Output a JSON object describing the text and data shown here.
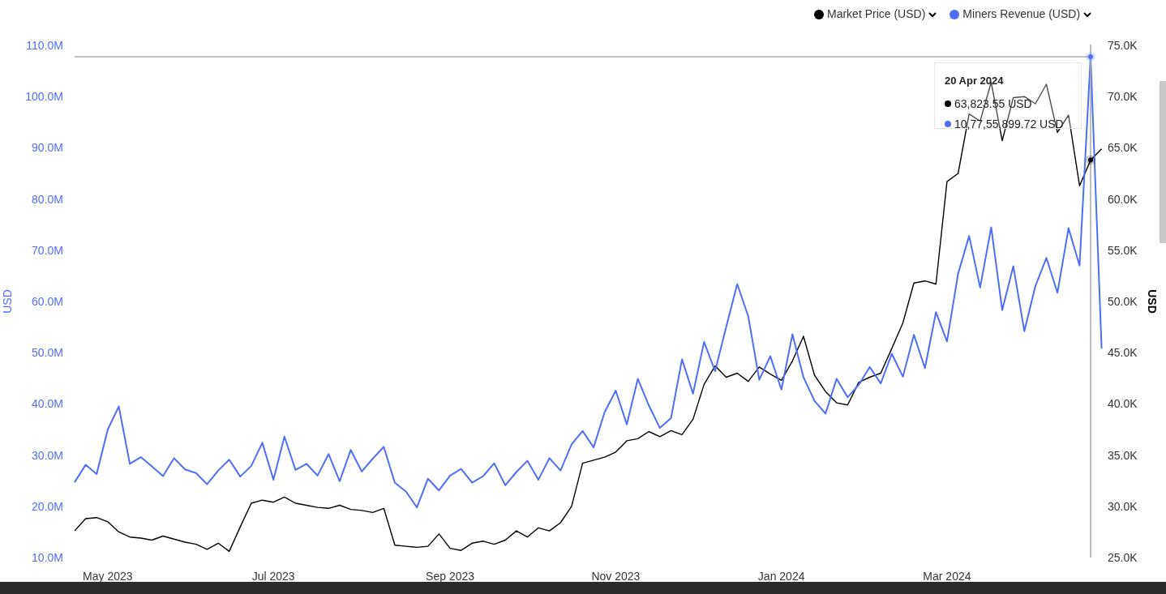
{
  "chart_data": {
    "type": "line",
    "ylabel": "USD",
    "y2label": "USD",
    "categories": [
      null,
      null,
      null,
      "May 2023",
      null,
      null,
      null,
      null,
      null,
      null,
      null,
      null,
      null,
      null,
      null,
      null,
      null,
      null,
      "Jul 2023",
      null,
      null,
      null,
      null,
      null,
      null,
      null,
      null,
      null,
      null,
      null,
      null,
      null,
      null,
      null,
      "Sep 2023",
      null,
      null,
      null,
      null,
      null,
      null,
      null,
      null,
      null,
      null,
      null,
      null,
      null,
      null,
      "Nov 2023",
      null,
      null,
      null,
      null,
      null,
      null,
      null,
      null,
      null,
      null,
      null,
      null,
      null,
      null,
      "Jan 2024",
      null,
      null,
      null,
      null,
      null,
      null,
      null,
      null,
      null,
      null,
      null,
      null,
      null,
      null,
      "Mar 2024",
      null,
      null,
      null,
      null,
      null,
      null,
      null,
      null,
      null,
      null,
      null,
      null,
      null,
      null
    ],
    "ylim": [
      10000000,
      110000000
    ],
    "yticks": [
      {
        "value": 10000000,
        "label": "10.0M"
      },
      {
        "value": 20000000,
        "label": "20.0M"
      },
      {
        "value": 30000000,
        "label": "30.0M"
      },
      {
        "value": 40000000,
        "label": "40.0M"
      },
      {
        "value": 50000000,
        "label": "50.0M"
      },
      {
        "value": 60000000,
        "label": "60.0M"
      },
      {
        "value": 70000000,
        "label": "70.0M"
      },
      {
        "value": 80000000,
        "label": "80.0M"
      },
      {
        "value": 90000000,
        "label": "90.0M"
      },
      {
        "value": 100000000,
        "label": "100.0M"
      },
      {
        "value": 110000000,
        "label": "110.0M"
      }
    ],
    "y2lim": [
      25000,
      75000
    ],
    "y2ticks": [
      {
        "value": 25000,
        "label": "25.0K"
      },
      {
        "value": 30000,
        "label": "30.0K"
      },
      {
        "value": 35000,
        "label": "35.0K"
      },
      {
        "value": 40000,
        "label": "40.0K"
      },
      {
        "value": 45000,
        "label": "45.0K"
      },
      {
        "value": 50000,
        "label": "50.0K"
      },
      {
        "value": 55000,
        "label": "55.0K"
      },
      {
        "value": 60000,
        "label": "60.0K"
      },
      {
        "value": 65000,
        "label": "65.0K"
      },
      {
        "value": 70000,
        "label": "70.0K"
      },
      {
        "value": 75000,
        "label": "75.0K"
      }
    ],
    "series": [
      {
        "name": "Market Price (USD)",
        "color": "#000000",
        "axis": "y2",
        "values": [
          27600,
          28800,
          28900,
          28500,
          27500,
          27000,
          26900,
          26700,
          27100,
          26800,
          26500,
          26300,
          25800,
          26400,
          25600,
          28000,
          30300,
          30600,
          30400,
          30900,
          30300,
          30100,
          29900,
          29800,
          30100,
          29700,
          29600,
          29400,
          29800,
          26200,
          26100,
          26000,
          26100,
          27300,
          25900,
          25700,
          26400,
          26600,
          26300,
          26700,
          27600,
          27000,
          27900,
          27600,
          28400,
          30000,
          34200,
          34500,
          34800,
          35300,
          36400,
          36600,
          37300,
          36800,
          37400,
          37000,
          38500,
          41900,
          43700,
          42600,
          43000,
          42200,
          43600,
          42900,
          42300,
          44200,
          46600,
          42800,
          41200,
          40100,
          39900,
          42100,
          42600,
          43000,
          45400,
          47900,
          51800,
          52000,
          51700,
          61700,
          62500,
          68300,
          67600,
          71400,
          65700,
          69900,
          70000,
          69300,
          71200,
          66500,
          68200,
          61300,
          63800,
          64900
        ]
      },
      {
        "name": "Miners Revenue (USD)",
        "color": "#4f6ef7",
        "values": [
          24700000,
          28100000,
          26300000,
          35000000,
          39500000,
          28300000,
          29600000,
          27800000,
          25900000,
          29400000,
          27200000,
          26500000,
          24300000,
          27000000,
          29100000,
          25800000,
          27900000,
          32400000,
          25200000,
          33600000,
          27100000,
          28300000,
          26000000,
          30200000,
          24900000,
          31000000,
          26800000,
          29300000,
          31600000,
          24600000,
          22900000,
          19800000,
          25400000,
          23100000,
          26000000,
          27300000,
          24600000,
          25900000,
          28400000,
          24100000,
          26700000,
          28900000,
          25200000,
          29400000,
          27000000,
          32100000,
          34700000,
          31500000,
          38400000,
          42600000,
          36000000,
          44900000,
          39700000,
          35300000,
          37200000,
          48700000,
          42000000,
          52100000,
          46400000,
          55000000,
          63400000,
          57100000,
          44700000,
          49300000,
          42800000,
          53600000,
          45200000,
          40600000,
          38100000,
          44900000,
          41300000,
          43700000,
          47200000,
          44000000,
          49800000,
          45300000,
          53500000,
          47000000,
          57900000,
          52200000,
          65400000,
          72800000,
          62700000,
          74500000,
          58300000,
          66900000,
          54200000,
          63000000,
          68500000,
          61700000,
          74300000,
          67000000,
          107800000,
          50800000
        ]
      }
    ],
    "ref_lines": [
      {
        "axis": "y",
        "value": 107800000
      }
    ]
  },
  "tooltip": {
    "date": "20 Apr 2024",
    "items": [
      {
        "text": "63,823.55 USD",
        "color": "#000000"
      },
      {
        "text": "10,77,55,899.72 USD",
        "color": "#4f6ef7"
      }
    ]
  }
}
